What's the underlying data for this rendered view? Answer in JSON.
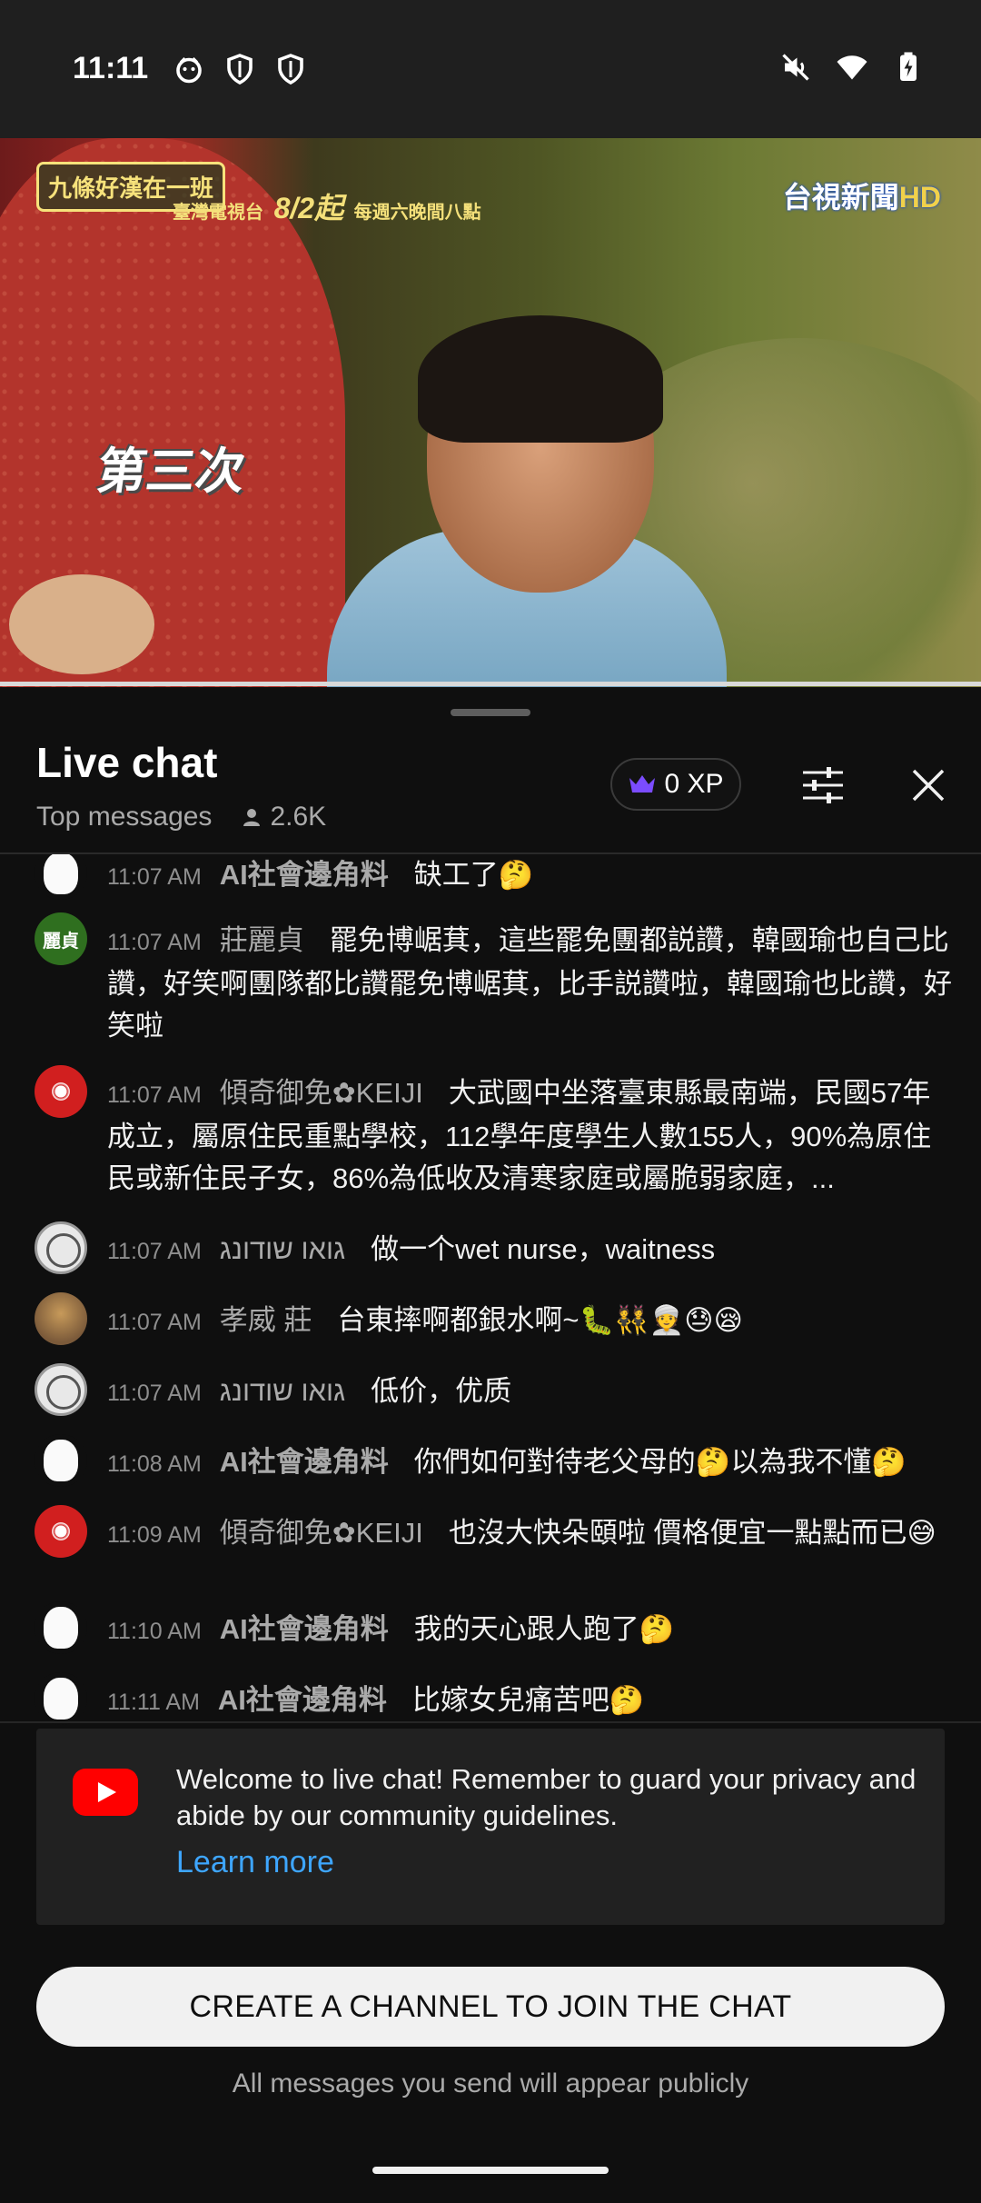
{
  "status_bar": {
    "time": "11:11",
    "left_icons": [
      "face-icon",
      "shield-icon",
      "shield-icon"
    ],
    "right_icons": [
      "mute-icon",
      "wifi-icon",
      "battery-icon"
    ]
  },
  "video": {
    "show_logo": "九條好漢在一班",
    "broadcast_network": "臺灣電視台",
    "broadcast_date": "8/2起",
    "broadcast_time": "每週六晚間八點",
    "channel_logo": "台視新聞",
    "channel_hd": "HD",
    "caption": "第三次",
    "progress": 1.0
  },
  "chat": {
    "title": "Live chat",
    "mode": "Top messages",
    "viewer_count": "2.6K",
    "xp_label": "0 XP",
    "messages": [
      {
        "time": "11:07 AM",
        "author": "AI社會邊角料",
        "text": "缺工了🤔",
        "avatar": "moomin"
      },
      {
        "time": "11:07 AM",
        "author": "莊麗貞",
        "text": "罷免博崌萁，這些罷免團都説讚，韓國瑜也自己比讚，好笑啊團隊都比讚罷免博崌萁，比手説讚啦，韓國瑜也比讚，好笑啦",
        "avatar": "麗貞"
      },
      {
        "time": "11:07 AM",
        "author": "傾奇御免✿KEIJI",
        "text": "大武國中坐落臺東縣最南端，民國57年成立，屬原住民重點學校，112學年度學生人數155人，90%為原住民或新住民子女，86%為低收及清寒家庭或屬脆弱家庭，...",
        "avatar": "red"
      },
      {
        "time": "11:07 AM",
        "author": "גואו שודונג",
        "text": "做一个wet nurse，waitness",
        "avatar": "seal"
      },
      {
        "time": "11:07 AM",
        "author": "孝威 莊",
        "text": "台東摔啊都銀水啊~🐛👯👳😓😪",
        "avatar": "photo"
      },
      {
        "time": "11:07 AM",
        "author": "גואו שודונג",
        "text": "低价，优质",
        "avatar": "seal"
      },
      {
        "time": "11:08 AM",
        "author": "AI社會邊角料",
        "text": "你們如何對待老父母的🤔以為我不懂🤔",
        "avatar": "moomin"
      },
      {
        "time": "11:09 AM",
        "author": "傾奇御免✿KEIJI",
        "text": "也沒大快朵頤啦 價格便宜一點點而已😅",
        "avatar": "red"
      },
      {
        "time": "11:10 AM",
        "author": "AI社會邊角料",
        "text": "我的天心跟人跑了🤔",
        "avatar": "moomin"
      },
      {
        "time": "11:11 AM",
        "author": "AI社會邊角料",
        "text": "比嫁女兒痛苦吧🤔",
        "avatar": "moomin"
      }
    ],
    "welcome_text": "Welcome to live chat! Remember to guard your privacy and abide by our community guidelines.",
    "learn_more": "Learn more",
    "create_button": "CREATE A CHANNEL TO JOIN THE CHAT",
    "public_note": "All messages you send will appear publicly"
  },
  "colors": {
    "background": "#0f0f0f",
    "link": "#3ea6ff",
    "xp_crown": "#7b4cff",
    "youtube_red": "#ff0000"
  }
}
